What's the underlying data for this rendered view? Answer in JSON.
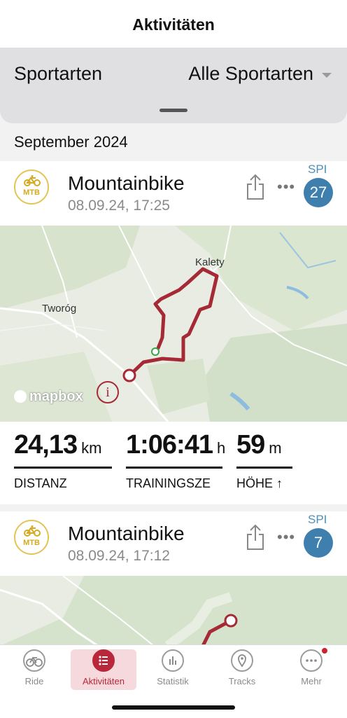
{
  "header": {
    "title": "Aktivitäten"
  },
  "filter": {
    "label": "Sportarten",
    "value": "Alle Sportarten"
  },
  "section": {
    "month": "September 2024"
  },
  "activities": [
    {
      "badge": "MTB",
      "sport": "Mountainbike",
      "datetime": "08.09.24, 17:25",
      "spi_label": "SPI",
      "spi": "27",
      "map": {
        "labels": [
          "Kalety",
          "Tworóg"
        ],
        "attribution": "mapbox",
        "info": "i"
      },
      "stats": [
        {
          "value": "24,13",
          "unit": "km",
          "caption": "DISTANZ"
        },
        {
          "value": "1:06:41",
          "unit": "h",
          "caption": "TRAININGSZE"
        },
        {
          "value": "59",
          "unit": "m",
          "caption": "HÖHE ↑"
        }
      ]
    },
    {
      "badge": "MTB",
      "sport": "Mountainbike",
      "datetime": "08.09.24, 17:12",
      "spi_label": "SPI",
      "spi": "7"
    }
  ],
  "tabs": [
    {
      "label": "Ride",
      "icon": "bike-icon",
      "active": false
    },
    {
      "label": "Aktivitäten",
      "icon": "list-icon",
      "active": true
    },
    {
      "label": "Statistik",
      "icon": "bar-chart-icon",
      "active": false
    },
    {
      "label": "Tracks",
      "icon": "map-pin-icon",
      "active": false
    },
    {
      "label": "Mehr",
      "icon": "more-icon",
      "active": false,
      "notification": true
    }
  ],
  "colors": {
    "accent": "#b8283a",
    "spi": "#3e7fae",
    "mtb": "#d3aa20",
    "route": "#a52a36"
  }
}
